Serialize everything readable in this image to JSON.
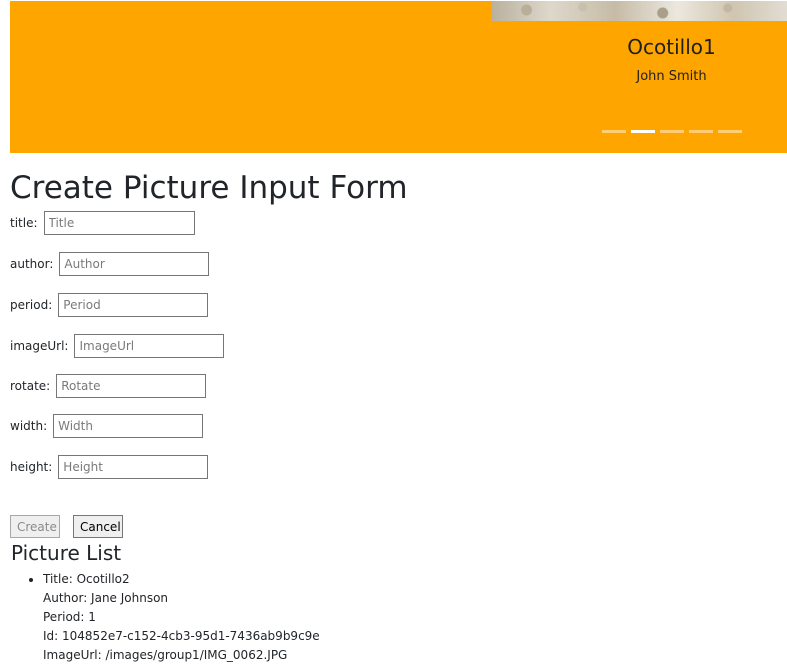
{
  "carousel": {
    "slide_title": "Ocotillo1",
    "slide_author": "John Smith",
    "indicator_count": 5,
    "active_index": 1,
    "background": "#ffa500"
  },
  "form": {
    "heading": "Create Picture Input Form",
    "fields": [
      {
        "label": "title:",
        "placeholder": "Title"
      },
      {
        "label": "author:",
        "placeholder": "Author"
      },
      {
        "label": "period:",
        "placeholder": "Period"
      },
      {
        "label": "imageUrl:",
        "placeholder": "ImageUrl"
      },
      {
        "label": "rotate:",
        "placeholder": "Rotate"
      },
      {
        "label": "width:",
        "placeholder": "Width"
      },
      {
        "label": "height:",
        "placeholder": "Height"
      }
    ],
    "create_label": "Create",
    "cancel_label": "Cancel"
  },
  "picture_list": {
    "heading": "Picture List",
    "items": [
      {
        "title": "Title: Ocotillo2",
        "author": "Author: Jane Johnson",
        "period": "Period: 1",
        "id": "Id: 104852e7-c152-4cb3-95d1-7436ab9b9c9e",
        "image_url": "ImageUrl: /images/group1/IMG_0062.JPG"
      }
    ]
  }
}
